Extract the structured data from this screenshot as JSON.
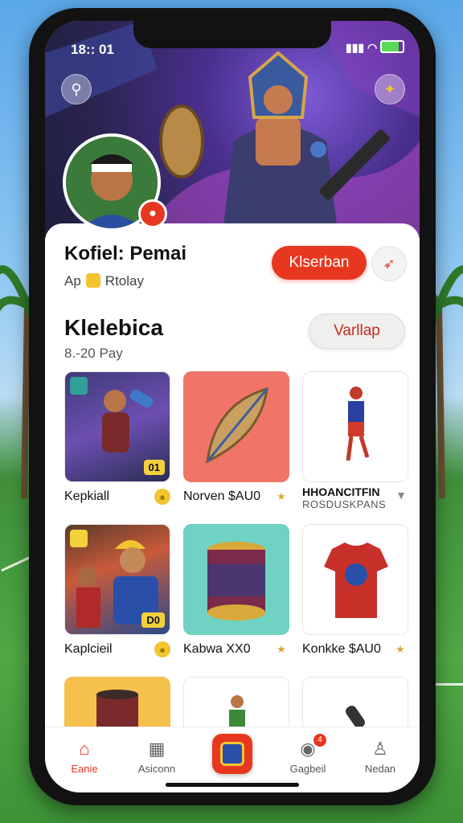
{
  "status_bar": {
    "time": "18:: 01"
  },
  "profile": {
    "name": "Kofiel: Pemai",
    "sub_prefix": "Ap",
    "sub_label": "Rtolay",
    "primary_button": "Klserban"
  },
  "section": {
    "title": "Klelebica",
    "subtitle": "8.-20 Pay",
    "button": "Varllap"
  },
  "items": [
    {
      "label": "Kepkiall",
      "tag": "01",
      "icon": "coin-icon"
    },
    {
      "label": "Norven $AU0",
      "icon": "star-icon"
    },
    {
      "label": "HHOANCITFIN",
      "sub": "ROSDUSKPANS",
      "icon": "chevron-down-icon"
    },
    {
      "label": "Kaplcieil",
      "tag": "D0",
      "icon": "coin-icon"
    },
    {
      "label": "Kabwa XX0",
      "icon": "star-icon"
    },
    {
      "label": "Konkke $AU0",
      "icon": "star-icon"
    }
  ],
  "nav": [
    {
      "label": "Eanie",
      "icon": "home-icon",
      "active": true
    },
    {
      "label": "Asiconn",
      "icon": "store-icon"
    },
    {
      "label": "",
      "icon": "center-badge-icon"
    },
    {
      "label": "Gagbeil",
      "icon": "chat-icon",
      "badge": "4"
    },
    {
      "label": "Nedan",
      "icon": "user-icon"
    }
  ],
  "colors": {
    "accent": "#e8371f",
    "coin": "#f2c530"
  }
}
